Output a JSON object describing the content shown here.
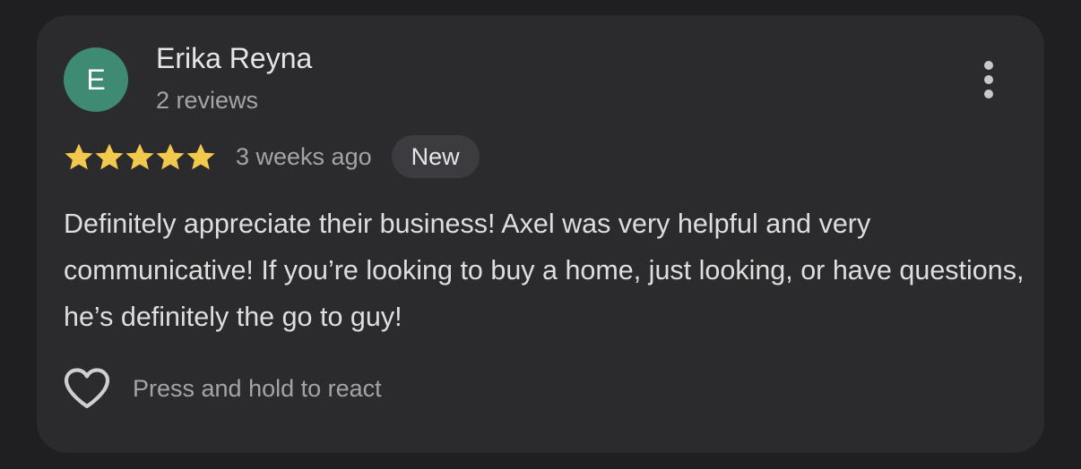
{
  "review": {
    "avatar_initial": "E",
    "avatar_color": "#3f8a72",
    "reviewer_name": "Erika Reyna",
    "review_count": "2 reviews",
    "rating": 5,
    "rating_max": 5,
    "star_color": "#f3c94d",
    "time_ago": "3 weeks ago",
    "badge": "New",
    "text": "Definitely appreciate their business! Axel was very helpful and very communicative! If you’re looking to buy a home, just looking, or have questions, he’s definitely the go to guy!",
    "more_icon": "more-vert-icon",
    "react_icon": "heart-outline-icon",
    "react_label": "Press and hold to react"
  }
}
